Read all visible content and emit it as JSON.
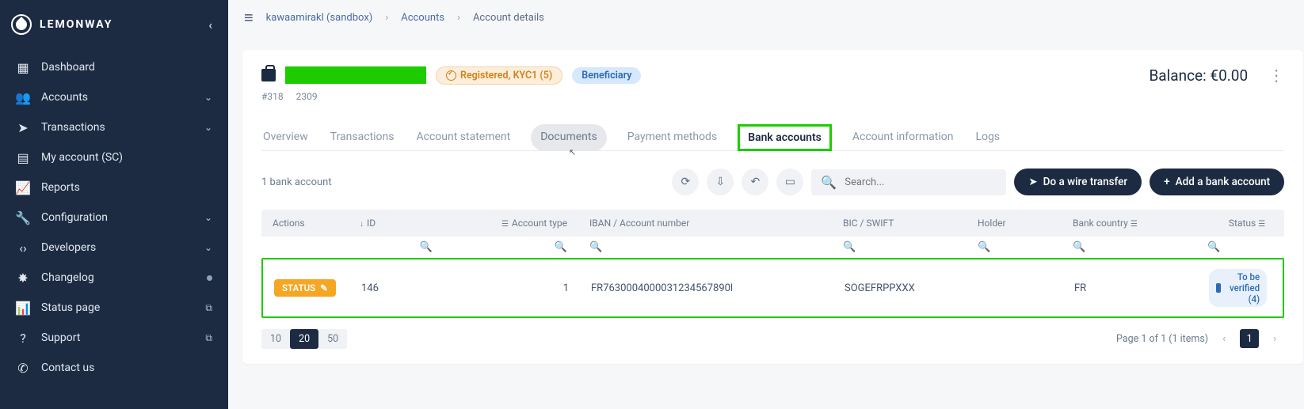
{
  "brand": "LEMONWAY",
  "sidebar": {
    "items": [
      {
        "label": "Dashboard",
        "icon": "▦",
        "expand": false
      },
      {
        "label": "Accounts",
        "icon": "👥",
        "expand": true
      },
      {
        "label": "Transactions",
        "icon": "➤",
        "expand": true
      },
      {
        "label": "My account (SC)",
        "icon": "▤",
        "expand": false
      },
      {
        "label": "Reports",
        "icon": "📈",
        "expand": false
      },
      {
        "label": "Configuration",
        "icon": "🔧",
        "expand": true
      },
      {
        "label": "Developers",
        "icon": "‹›",
        "expand": true
      },
      {
        "label": "Changelog",
        "icon": "✸",
        "expand": false,
        "dot": true
      },
      {
        "label": "Status page",
        "icon": "📊",
        "expand": false,
        "ext": true
      },
      {
        "label": "Support",
        "icon": "?",
        "expand": false,
        "ext": true
      },
      {
        "label": "Contact us",
        "icon": "✆",
        "expand": false
      }
    ]
  },
  "breadcrumbs": {
    "env": "kawaamirakl (sandbox)",
    "l1": "Accounts",
    "l2": "Account details"
  },
  "header": {
    "kyc_pill": "Registered, KYC1 (5)",
    "role_pill": "Beneficiary",
    "id1": "#318",
    "id2": "2309",
    "balance": "Balance: €0.00"
  },
  "tabs": [
    "Overview",
    "Transactions",
    "Account statement",
    "Documents",
    "Payment methods",
    "Bank accounts",
    "Account information",
    "Logs"
  ],
  "toolbar": {
    "count": "1 bank account",
    "search_ph": "Search...",
    "wire": "Do a wire transfer",
    "add": "Add a bank account"
  },
  "columns": {
    "actions": "Actions",
    "id": "ID",
    "type": "Account type",
    "iban": "IBAN / Account number",
    "bic": "BIC / SWIFT",
    "holder": "Holder",
    "country": "Bank country",
    "status": "Status"
  },
  "row": {
    "status_btn": "STATUS",
    "id": "146",
    "type": "1",
    "iban": "FR7630004000031234567890l",
    "bic": "SOGEFRPPXXX",
    "holder": "",
    "country": "FR",
    "verify": "To be verified (4)"
  },
  "pager": {
    "sizes": [
      "10",
      "20",
      "50"
    ],
    "active": "20",
    "info": "Page 1 of 1 (1 items)",
    "page": "1"
  }
}
